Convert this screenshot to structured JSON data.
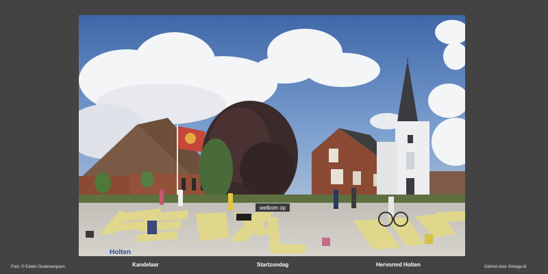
{
  "photo": {
    "alt_subject": "village square with church, trees, and chalk letters on pavement",
    "sign_text": "welkom op",
    "chalk_text": "Holten"
  },
  "footer": {
    "credit_left": "Foto: © Edwin Oudenampsen",
    "credit_right": "Gehost door Omega-id",
    "nav": [
      {
        "label": "Kandelaar"
      },
      {
        "label": "Startzondag"
      },
      {
        "label": "Hervormd Holten"
      }
    ]
  },
  "colors": {
    "background": "#434343",
    "sky": "#5f87c0",
    "pavement": "#c9c8c2",
    "chalk_letters": "#e2d88a",
    "brick": "#8a4a34"
  }
}
